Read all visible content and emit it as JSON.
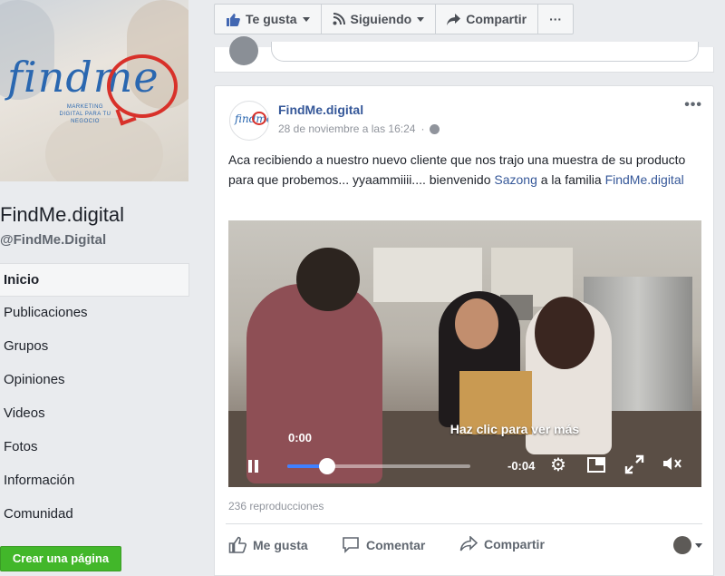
{
  "page": {
    "name": "FindMe.digital",
    "handle": "@FindMe.Digital",
    "logo_text": "findme",
    "logo_tagline": "MARKETING DIGITAL PARA TU NEGOCIO"
  },
  "sidebar": {
    "items": [
      {
        "label": "Inicio",
        "active": true
      },
      {
        "label": "Publicaciones"
      },
      {
        "label": "Grupos"
      },
      {
        "label": "Opiniones"
      },
      {
        "label": "Videos"
      },
      {
        "label": "Fotos"
      },
      {
        "label": "Información"
      },
      {
        "label": "Comunidad"
      }
    ],
    "create_page_label": "Crear una página"
  },
  "topbar": {
    "like_label": "Te gusta",
    "follow_label": "Siguiendo",
    "share_label": "Compartir",
    "more_label": "···"
  },
  "post": {
    "author": "FindMe.digital",
    "timestamp": "28 de noviembre a las 16:24",
    "more_label": "•••",
    "text_part1": "Aca recibiendo a nuestro nuevo cliente que nos trajo una muestra de su producto para que probemos... yyaammiiii.... bienvenido ",
    "mention_sazong": "Sazong",
    "text_part2": " a la familia ",
    "mention_findme": "FindMe.digital",
    "video": {
      "overlay_text": "Haz clic para ver más",
      "current_time": "0:00",
      "remaining_time": "-0:04",
      "progress": 0.22
    },
    "views": "236 reproducciones",
    "actions": {
      "like": "Me gusta",
      "comment": "Comentar",
      "share": "Compartir"
    }
  },
  "colors": {
    "link": "#365899",
    "green_button": "#42b72a",
    "video_progress": "#4080ff",
    "brand_blue": "#2a67b0",
    "brand_red": "#d8312a"
  }
}
